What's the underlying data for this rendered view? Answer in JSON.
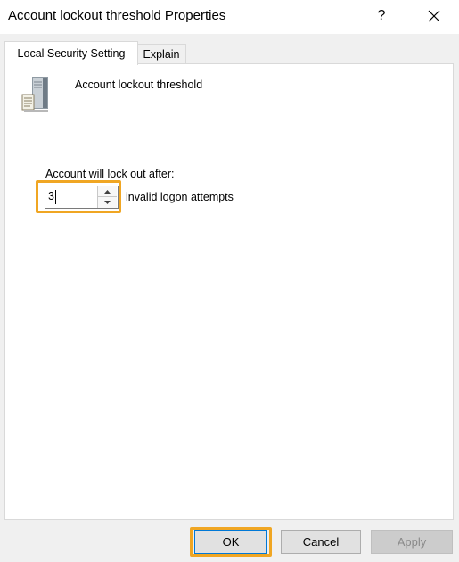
{
  "window": {
    "title": "Account lockout threshold Properties",
    "help_label": "?"
  },
  "tabs": [
    {
      "label": "Local Security Setting",
      "active": true
    },
    {
      "label": "Explain",
      "active": false
    }
  ],
  "policy": {
    "icon": "server-policy-icon",
    "name": "Account lockout threshold"
  },
  "setting": {
    "prefix_label": "Account will lock out after:",
    "value": "3",
    "suffix_label": "invalid logon attempts"
  },
  "buttons": {
    "ok": "OK",
    "cancel": "Cancel",
    "apply": "Apply"
  },
  "colors": {
    "highlight": "#f0a623",
    "focus_border": "#0078d7"
  }
}
